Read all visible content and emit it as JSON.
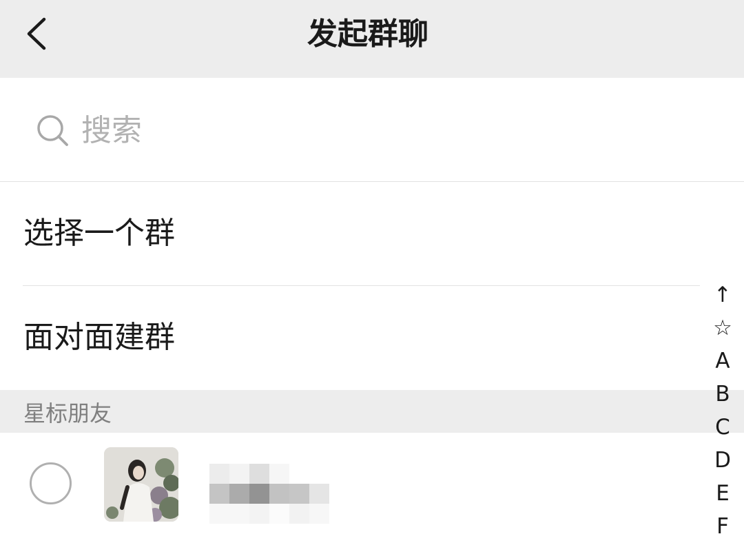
{
  "nav": {
    "title": "发起群聊",
    "back_icon": "chevron-left-icon"
  },
  "search": {
    "placeholder": "搜索",
    "value": "",
    "icon": "search-icon"
  },
  "actions": [
    {
      "label": "选择一个群"
    },
    {
      "label": "面对面建群"
    }
  ],
  "section": {
    "label": "星标朋友"
  },
  "contacts": [
    {
      "name": "",
      "selected": false,
      "avatar": "avatar-image",
      "name_pixelated": true
    }
  ],
  "index": [
    "↑",
    "☆",
    "A",
    "B",
    "C",
    "D",
    "E",
    "F"
  ],
  "colors": {
    "nav_background": "#ededed",
    "section_background": "#ededed",
    "placeholder": "#b2b2b2",
    "section_text": "#7f7f7f",
    "checkbox_border": "#b0b0b0",
    "text": "#1a1a1a"
  }
}
